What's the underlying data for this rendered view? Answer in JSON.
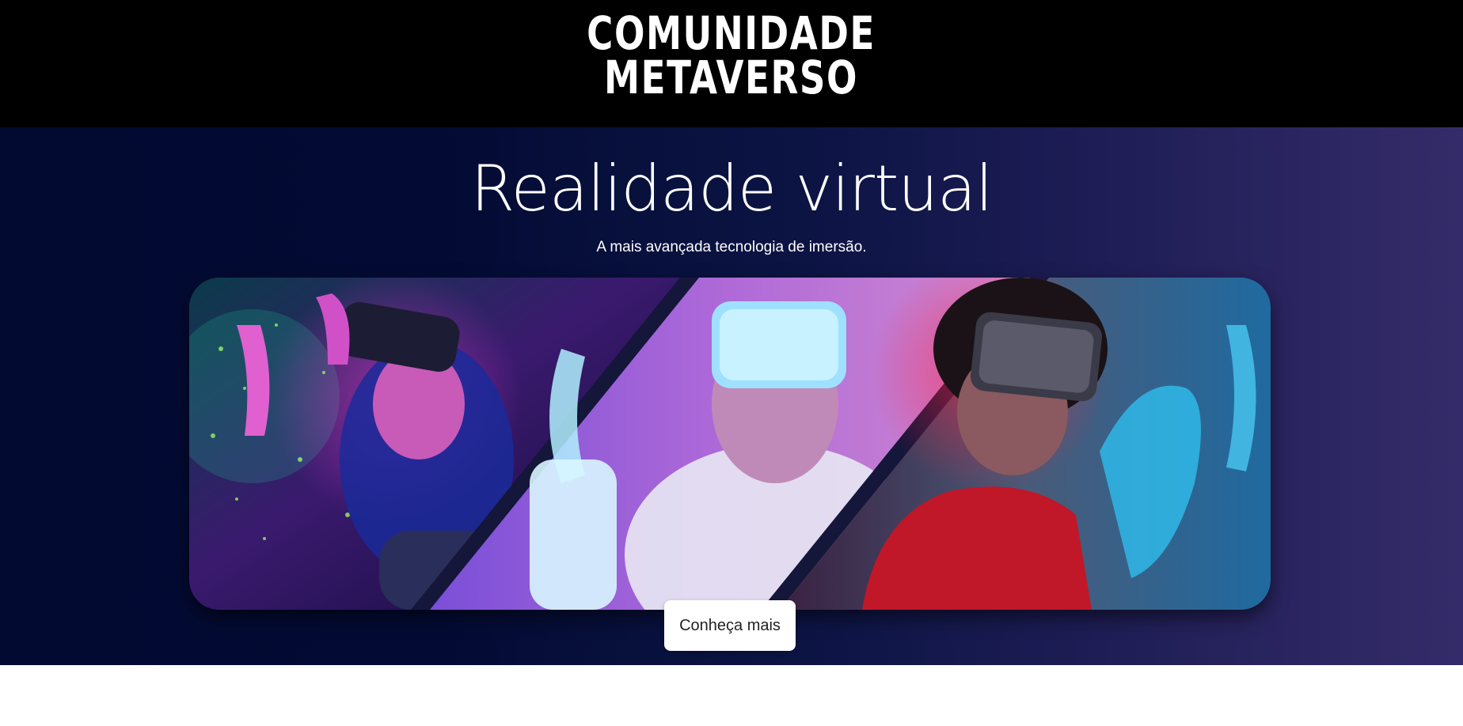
{
  "header": {
    "logo_line1": "COMUNIDADE",
    "logo_line2": "METAVERSO"
  },
  "hero": {
    "title": "Realidade virtual",
    "subtitle": "A mais avançada tecnologia de imersão.",
    "cta_label": "Conheça mais"
  },
  "colors": {
    "topbar": "#000000",
    "hero_start": "#020a32",
    "hero_end": "#342c6a",
    "button_bg": "#ffffff"
  }
}
